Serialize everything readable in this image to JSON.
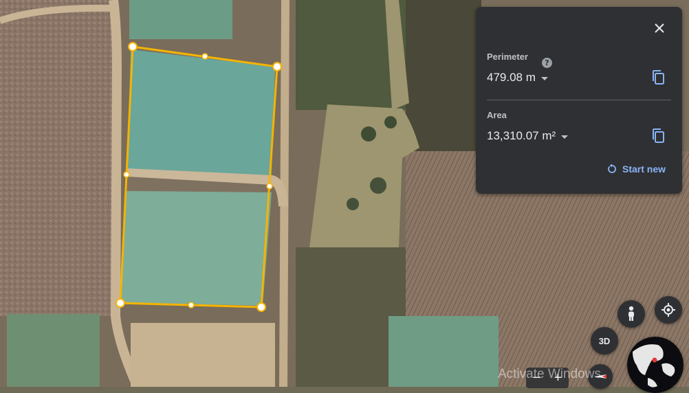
{
  "panel": {
    "perimeter_label": "Perimeter",
    "help_glyph": "?",
    "perimeter_value": "479.08 m",
    "area_label": "Area",
    "area_value": "13,310.07 m²",
    "start_new_label": "Start new",
    "close_icon": "close-icon",
    "copy_icon": "copy-icon"
  },
  "controls": {
    "view_3d_label": "3D",
    "zoom_out": "−",
    "zoom_in": "+"
  },
  "overlay": {
    "watermark_text": "Activate Windows"
  },
  "colors": {
    "accent_blue": "#8ab4f8",
    "measure_line": "#f5b400",
    "panel_bg": "#2f3033"
  }
}
